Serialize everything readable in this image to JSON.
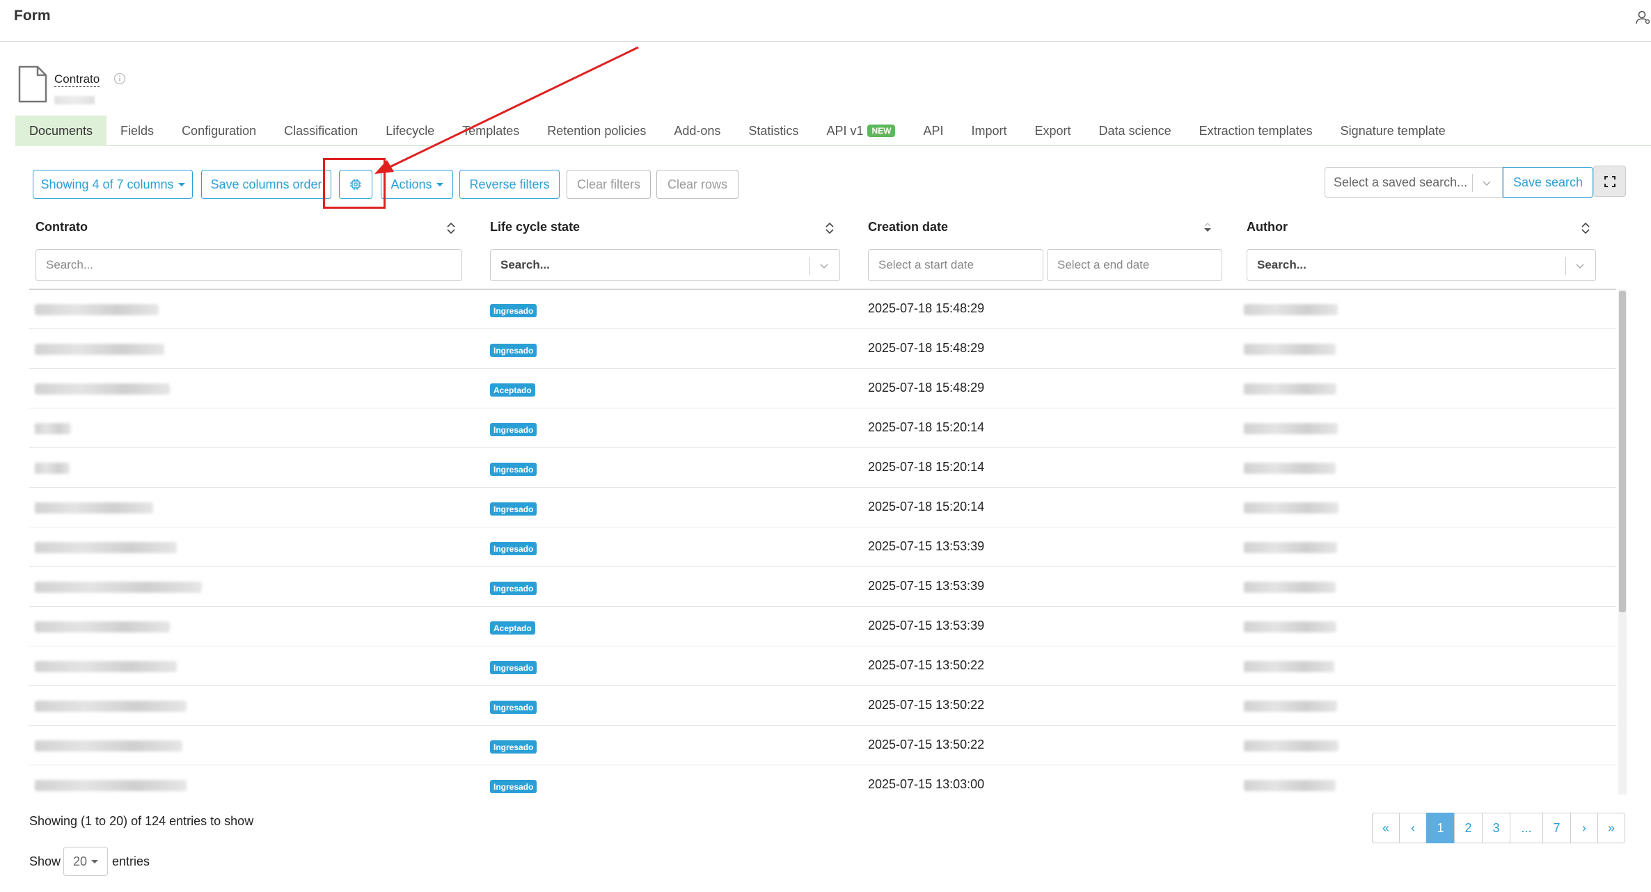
{
  "header": {
    "title": "Form"
  },
  "document": {
    "name": "Contrato"
  },
  "tabs": [
    {
      "label": "Documents",
      "active": true
    },
    {
      "label": "Fields"
    },
    {
      "label": "Configuration"
    },
    {
      "label": "Classification"
    },
    {
      "label": "Lifecycle"
    },
    {
      "label": "Templates"
    },
    {
      "label": "Retention policies"
    },
    {
      "label": "Add-ons"
    },
    {
      "label": "Statistics"
    },
    {
      "label": "API v1",
      "badge": "NEW"
    },
    {
      "label": "API"
    },
    {
      "label": "Import"
    },
    {
      "label": "Export"
    },
    {
      "label": "Data science"
    },
    {
      "label": "Extraction templates"
    },
    {
      "label": "Signature template"
    }
  ],
  "toolbar": {
    "columns_label": "Showing 4 of 7 columns",
    "save_order_label": "Save columns order",
    "actions_label": "Actions",
    "reverse_filters_label": "Reverse filters",
    "clear_filters_label": "Clear filters",
    "clear_rows_label": "Clear rows",
    "saved_search_placeholder": "Select a saved search...",
    "save_search_label": "Save search"
  },
  "columns": {
    "contrato": {
      "header": "Contrato",
      "filter_placeholder": "Search..."
    },
    "lifecycle": {
      "header": "Life cycle state",
      "filter_placeholder": "Search..."
    },
    "creation": {
      "header": "Creation date",
      "start_placeholder": "Select a start date",
      "end_placeholder": "Select a end date"
    },
    "author": {
      "header": "Author",
      "filter_placeholder": "Search..."
    }
  },
  "rows": [
    {
      "state": "Ingresado",
      "date": "2025-07-18 15:48:29"
    },
    {
      "state": "Ingresado",
      "date": "2025-07-18 15:48:29"
    },
    {
      "state": "Aceptado",
      "date": "2025-07-18 15:48:29"
    },
    {
      "state": "Ingresado",
      "date": "2025-07-18 15:20:14"
    },
    {
      "state": "Ingresado",
      "date": "2025-07-18 15:20:14"
    },
    {
      "state": "Ingresado",
      "date": "2025-07-18 15:20:14"
    },
    {
      "state": "Ingresado",
      "date": "2025-07-15 13:53:39"
    },
    {
      "state": "Ingresado",
      "date": "2025-07-15 13:53:39"
    },
    {
      "state": "Aceptado",
      "date": "2025-07-15 13:53:39"
    },
    {
      "state": "Ingresado",
      "date": "2025-07-15 13:50:22"
    },
    {
      "state": "Ingresado",
      "date": "2025-07-15 13:50:22"
    },
    {
      "state": "Ingresado",
      "date": "2025-07-15 13:50:22"
    },
    {
      "state": "Ingresado",
      "date": "2025-07-15 13:03:00"
    }
  ],
  "footer": {
    "entries_info": "Showing (1 to 20) of 124 entries to show",
    "show_label": "Show",
    "page_size": "20",
    "entries_label": "entries"
  },
  "pagination": [
    "«",
    "‹",
    "1",
    "2",
    "3",
    "...",
    "7",
    "›",
    "»"
  ],
  "colors": {
    "accent": "#2a9fd6",
    "tab_active_bg": "#dff0d8",
    "highlight": "#e02020"
  }
}
